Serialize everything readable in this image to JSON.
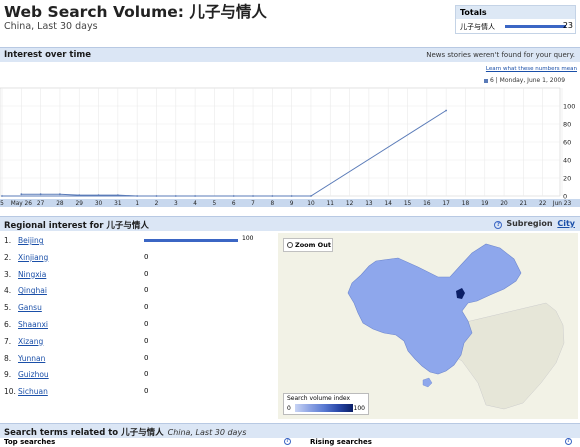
{
  "page": {
    "title": "Web Search Volume: 儿子与情人",
    "subtitle": "China, Last 30 days"
  },
  "totals": {
    "header": "Totals",
    "term": "儿子与情人",
    "value": "23",
    "bar_fraction": 1.0
  },
  "interest_section": {
    "title": "Interest over time",
    "note": "News stories weren't found for your query.",
    "learn_link": "Learn what these numbers mean",
    "legend_count": "6",
    "legend_date": "Monday, June 1, 2009"
  },
  "chart_data": {
    "type": "line",
    "title": "",
    "xlabel": "",
    "ylabel": "",
    "x_tick_labels": [
      "5",
      "May 26",
      "27",
      "28",
      "29",
      "30",
      "31",
      "1",
      "2",
      "3",
      "4",
      "5",
      "6",
      "7",
      "8",
      "9",
      "10",
      "11",
      "12",
      "13",
      "14",
      "15",
      "16",
      "17",
      "18",
      "19",
      "20",
      "21",
      "22",
      "Jun 23"
    ],
    "y_ticks": [
      0,
      20,
      40,
      60,
      80,
      100
    ],
    "ylim": [
      0,
      120
    ],
    "grid": true,
    "series": [
      {
        "color": "#5a7bb8",
        "x": [
          "May 26",
          "27",
          "28",
          "29",
          "30",
          "31",
          "1",
          "2",
          "3",
          "4",
          "5",
          "6",
          "7",
          "8",
          "9",
          "10",
          "17"
        ],
        "values": [
          2,
          2,
          2,
          1,
          1,
          1,
          0,
          0,
          0,
          0,
          0,
          0,
          0,
          0,
          0,
          0,
          95
        ]
      }
    ]
  },
  "regional_section": {
    "title": "Regional interest",
    "title_for": "for 儿子与情人",
    "subregion_label": "Subregion",
    "city_link": "City",
    "help_icon": "question-circle-icon"
  },
  "regions": [
    {
      "rank": "1.",
      "name": "Beijing",
      "value": 100,
      "label": "100"
    },
    {
      "rank": "2.",
      "name": "Xinjiang",
      "value": 0,
      "label": "0"
    },
    {
      "rank": "3.",
      "name": "Ningxia",
      "value": 0,
      "label": "0"
    },
    {
      "rank": "4.",
      "name": "Qinghai",
      "value": 0,
      "label": "0"
    },
    {
      "rank": "5.",
      "name": "Gansu",
      "value": 0,
      "label": "0"
    },
    {
      "rank": "6.",
      "name": "Shaanxi",
      "value": 0,
      "label": "0"
    },
    {
      "rank": "7.",
      "name": "Xizang",
      "value": 0,
      "label": "0"
    },
    {
      "rank": "8.",
      "name": "Yunnan",
      "value": 0,
      "label": "0"
    },
    {
      "rank": "9.",
      "name": "Guizhou",
      "value": 0,
      "label": "0"
    },
    {
      "rank": "10.",
      "name": "Sichuan",
      "value": 0,
      "label": "0"
    }
  ],
  "map": {
    "zoom_out": "Zoom Out",
    "legend_title": "Search volume index",
    "legend_min": "0",
    "legend_max": "100",
    "china_color": "#8ea7ec",
    "highlight_color": "#0b1f66"
  },
  "related_section": {
    "title": "Search terms related to 儿子与情人",
    "note": "China, Last 30 days",
    "top_searches": "Top searches",
    "rising_searches": "Rising searches"
  }
}
